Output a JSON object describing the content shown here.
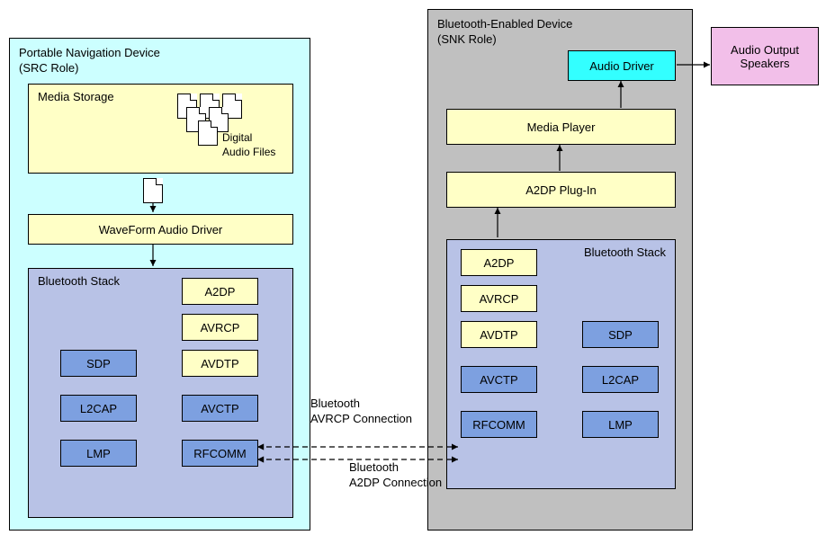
{
  "source": {
    "title": "Portable Navigation Device\n(SRC Role)",
    "media_storage": {
      "title": "Media Storage",
      "files_label": "Digital\nAudio Files"
    },
    "waveform": "WaveForm Audio Driver",
    "stack_title": "Bluetooth Stack",
    "stack": {
      "a2dp": "A2DP",
      "avrcp": "AVRCP",
      "sdp": "SDP",
      "avdtp": "AVDTP",
      "l2cap": "L2CAP",
      "avctp": "AVCTP",
      "lmp": "LMP",
      "rfcomm": "RFCOMM"
    }
  },
  "sink": {
    "title": "Bluetooth-Enabled Device\n(SNK Role)",
    "audio_driver": "Audio Driver",
    "media_player": "Media Player",
    "a2dp_plugin": "A2DP Plug-In",
    "stack_title": "Bluetooth Stack",
    "stack": {
      "a2dp": "A2DP",
      "avrcp": "AVRCP",
      "avdtp": "AVDTP",
      "sdp": "SDP",
      "avctp": "AVCTP",
      "l2cap": "L2CAP",
      "rfcomm": "RFCOMM",
      "lmp": "LMP"
    }
  },
  "speakers": "Audio Output\nSpeakers",
  "connections": {
    "avrcp": "Bluetooth\nAVRCP Connection",
    "a2dp": "Bluetooth\nA2DP Connection"
  },
  "colors": {
    "cyan": "#ccffff",
    "grey": "#c0c0c0",
    "pink": "#f2bfe9",
    "yellow": "#ffffc6",
    "purple": "#b8c2e6",
    "blue": "#7da0e0",
    "aqua": "#33ffff"
  }
}
